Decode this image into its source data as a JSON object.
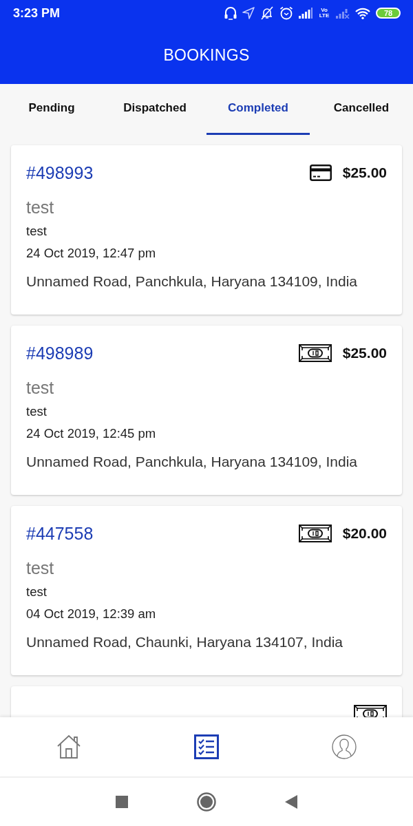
{
  "status_bar": {
    "time": "3:23 PM",
    "network_type": "Vo LTE",
    "battery": "78"
  },
  "header": {
    "title": "BOOKINGS"
  },
  "tabs": [
    {
      "label": "Pending",
      "selected": false
    },
    {
      "label": "Dispatched",
      "selected": false
    },
    {
      "label": "Completed",
      "selected": true
    },
    {
      "label": "Cancelled",
      "selected": false
    }
  ],
  "bookings": [
    {
      "id": "#498993",
      "kind": "card",
      "price": "$25.00",
      "title": "test",
      "note": "test",
      "date": "24 Oct 2019, 12:47 pm",
      "address": "Unnamed Road, Panchkula, Haryana 134109, India"
    },
    {
      "id": "#498989",
      "kind": "cash",
      "price": "$25.00",
      "title": "test",
      "note": "test",
      "date": "24 Oct 2019, 12:45 pm",
      "address": "Unnamed Road, Panchkula, Haryana 134109, India"
    },
    {
      "id": "#447558",
      "kind": "cash",
      "price": "$20.00",
      "title": "test",
      "note": "test",
      "date": "04 Oct 2019, 12:39 am",
      "address": "Unnamed Road, Chaunki, Haryana 134107, India"
    },
    {
      "kind": "cash"
    }
  ],
  "bottom_nav": [
    {
      "kind": "home",
      "selected": false
    },
    {
      "kind": "list",
      "selected": true
    },
    {
      "kind": "profile",
      "selected": false
    }
  ]
}
